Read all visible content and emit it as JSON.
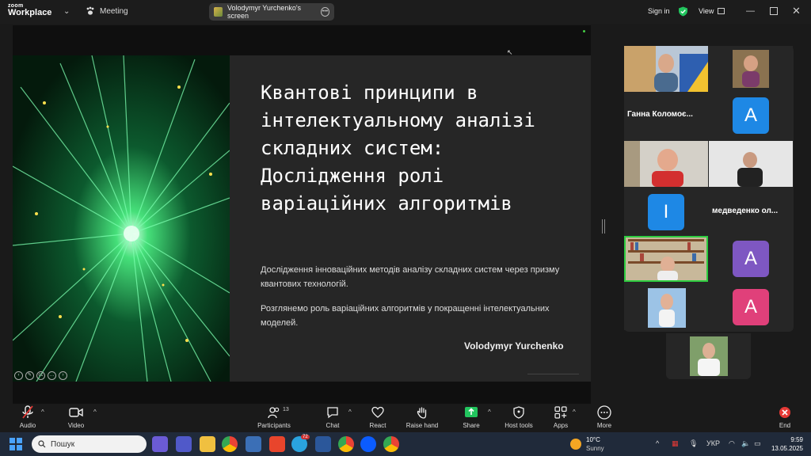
{
  "titlebar": {
    "logo_line1": "zoom",
    "logo_line2": "Workplace",
    "meeting_label": "Meeting",
    "screen_share_label": "Volodymyr Yurchenko's screen",
    "sign_in": "Sign in",
    "view": "View"
  },
  "slide": {
    "title": "Квантові принципи в інтелектуальному аналізі складних систем: Дослідження ролі варіаційних алгоритмів",
    "paragraph1": "Дослідження інноваційних методів аналізу складних систем через призму квантових технологій.",
    "paragraph2": "Розглянемо роль варіаційних алгоритмів у покращенні інтелектуальних моделей.",
    "author": "Volodymyr Yurchenko"
  },
  "gallery": {
    "tiles": [
      {
        "type": "video",
        "name": ""
      },
      {
        "type": "video",
        "name": ""
      },
      {
        "type": "name",
        "name": "Ганна Коломоє..."
      },
      {
        "type": "avatar",
        "letter": "A",
        "color": "#1e88e5"
      },
      {
        "type": "video",
        "name": ""
      },
      {
        "type": "video",
        "name": ""
      },
      {
        "type": "avatar",
        "letter": "I",
        "color": "#1e88e5"
      },
      {
        "type": "name",
        "name": "медведенко ол..."
      },
      {
        "type": "video",
        "name": ""
      },
      {
        "type": "avatar",
        "letter": "A",
        "color": "#7e57c2"
      },
      {
        "type": "video",
        "name": ""
      },
      {
        "type": "avatar",
        "letter": "A",
        "color": "#e0407a"
      },
      {
        "type": "video",
        "name": ""
      }
    ]
  },
  "toolbar": {
    "audio": "Audio",
    "video": "Video",
    "participants": "Participants",
    "participants_count": "13",
    "chat": "Chat",
    "react": "React",
    "raise_hand": "Raise hand",
    "share": "Share",
    "host_tools": "Host tools",
    "apps": "Apps",
    "more": "More",
    "end": "End"
  },
  "taskbar": {
    "search_placeholder": "Пошук",
    "telegram_badge": "72",
    "weather_temp": "10°C",
    "weather_desc": "Sunny",
    "language": "УКР",
    "time": "9:59",
    "date": "13.05.2025"
  },
  "colors": {
    "accent_green": "#2ecc40",
    "end_red": "#e53935",
    "share_green": "#22c55e"
  }
}
